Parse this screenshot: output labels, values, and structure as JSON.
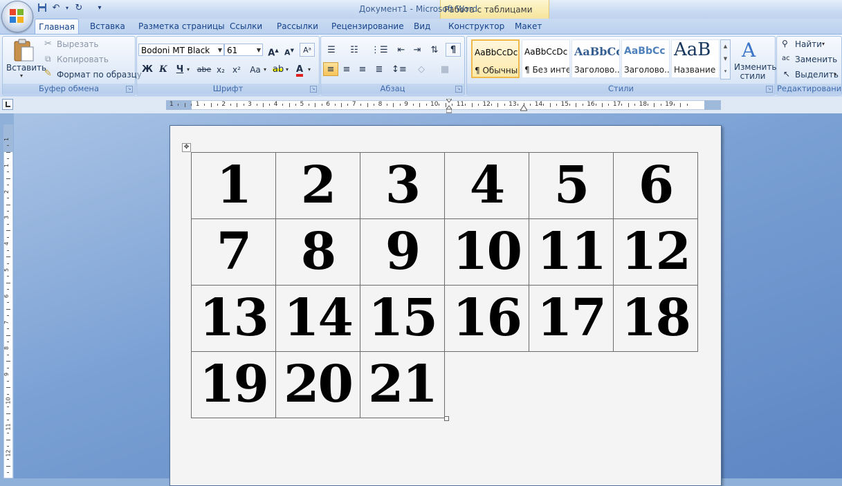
{
  "window": {
    "title": "Документ1 - Microsoft Word",
    "context_tab_group": "Работа с таблицами"
  },
  "tabs": [
    "Главная",
    "Вставка",
    "Разметка страницы",
    "Ссылки",
    "Рассылки",
    "Рецензирование",
    "Вид",
    "Конструктор",
    "Макет"
  ],
  "clipboard": {
    "paste": "Вставить",
    "cut": "Вырезать",
    "copy": "Копировать",
    "format_painter": "Формат по образцу",
    "label": "Буфер обмена"
  },
  "font": {
    "family": "Bodoni MT Black",
    "size": "61",
    "label": "Шрифт",
    "bold": "Ж",
    "italic": "К",
    "underline": "Ч",
    "strike": "abe",
    "subscript": "x₂",
    "superscript": "x²",
    "change_case": "Aa"
  },
  "paragraph": {
    "label": "Абзац"
  },
  "styles": {
    "label": "Стили",
    "items": [
      {
        "sample": "AaBbCcDc",
        "name": "¶ Обычный"
      },
      {
        "sample": "AaBbCcDc",
        "name": "¶ Без инте..."
      },
      {
        "sample": "AaBbCc",
        "name": "Заголово..."
      },
      {
        "sample": "AaBbCc",
        "name": "Заголово..."
      },
      {
        "sample": "AaB",
        "name": "Название"
      }
    ],
    "change_styles": "Изменить стили"
  },
  "editing": {
    "find": "Найти",
    "replace": "Заменить",
    "select": "Выделить",
    "label": "Редактирование"
  },
  "ruler": {
    "h_marks": [
      "1",
      "1",
      "2",
      "3",
      "4",
      "5",
      "6",
      "7",
      "8",
      "9",
      "10",
      "11",
      "12",
      "13",
      "14",
      "15",
      "16",
      "17",
      "18",
      "19"
    ],
    "v_marks": [
      "1",
      "1",
      "2",
      "3",
      "4",
      "5",
      "6",
      "7",
      "8",
      "9",
      "10",
      "11",
      "12"
    ]
  },
  "table": {
    "rows": [
      [
        "1",
        "2",
        "3",
        "4",
        "5",
        "6"
      ],
      [
        "7",
        "8",
        "9",
        "10",
        "11",
        "12"
      ],
      [
        "13",
        "14",
        "15",
        "16",
        "17",
        "18"
      ],
      [
        "19",
        "20",
        "21",
        "",
        "",
        ""
      ]
    ]
  },
  "colors": {
    "ribbon_bg": "#dae6f6",
    "page_bg": "#f4f4f4",
    "workspace": "#7aa0d4",
    "context_tab": "#f7e6a0"
  }
}
